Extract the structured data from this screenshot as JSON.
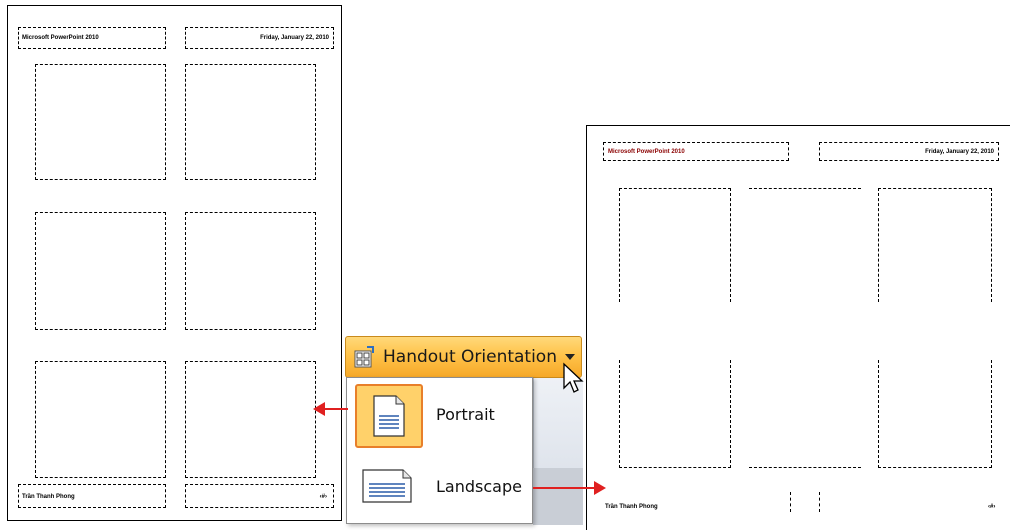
{
  "portrait_page": {
    "header_left": "Microsoft PowerPoint 2010",
    "header_right": "Friday, January 22, 2010",
    "footer_left": "Trần Thanh Phong",
    "footer_right": "‹#›"
  },
  "landscape_page": {
    "header_left": "Microsoft PowerPoint 2010",
    "header_right": "Friday, January 22, 2010",
    "footer_left": "Trần Thanh Phong",
    "footer_right": "‹#›"
  },
  "ribbon": {
    "button_label": "Handout Orientation",
    "icon": "handout-orientation-icon"
  },
  "menu": {
    "items": [
      {
        "label": "Portrait",
        "icon": "portrait-page-icon",
        "selected": true
      },
      {
        "label": "Landscape",
        "icon": "landscape-page-icon",
        "selected": false
      }
    ]
  },
  "colors": {
    "ribbon_button": "#ffc34a",
    "selected_item": "#ffd16a",
    "arrow": "#e02020"
  }
}
